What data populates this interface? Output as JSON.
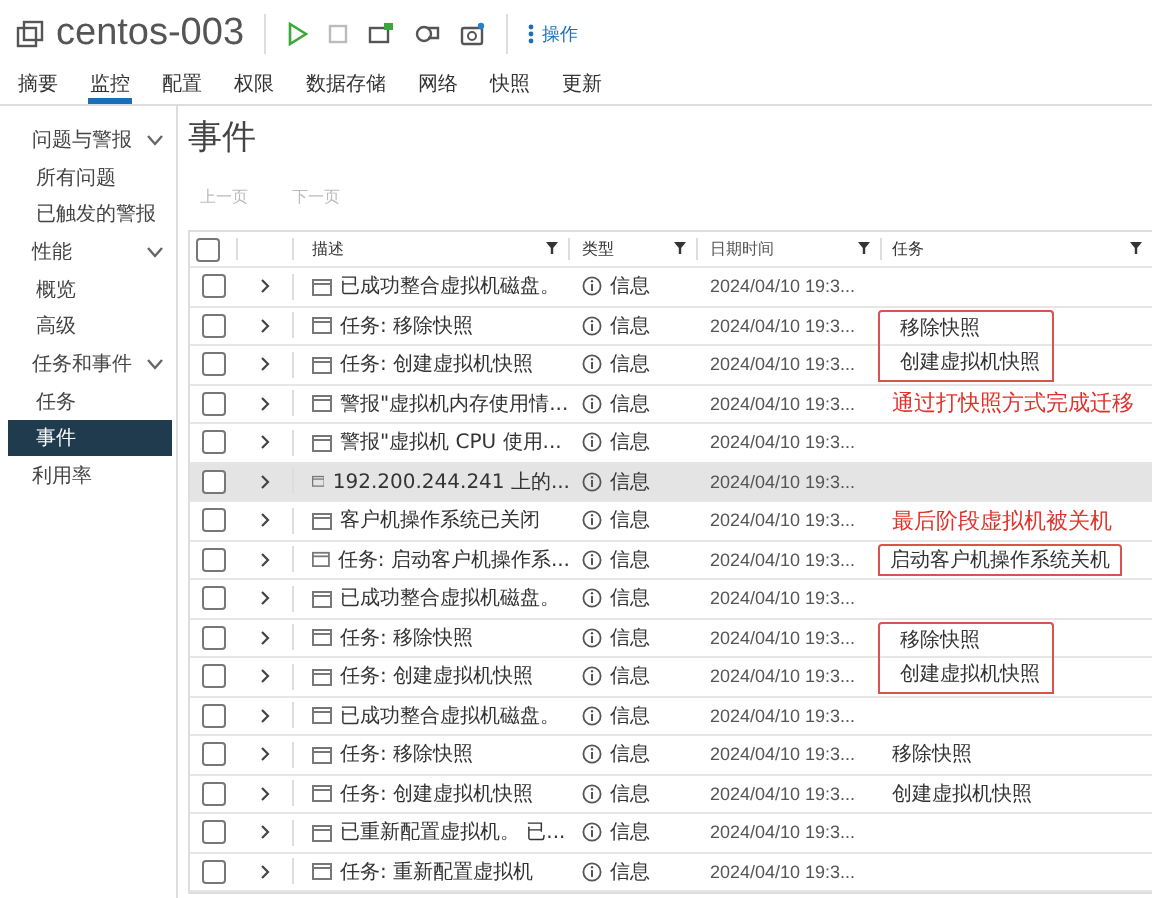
{
  "header": {
    "title": "centos-003",
    "actions_label": "操作"
  },
  "tabs": [
    {
      "label": "摘要",
      "selected": false
    },
    {
      "label": "监控",
      "selected": true
    },
    {
      "label": "配置",
      "selected": false
    },
    {
      "label": "权限",
      "selected": false
    },
    {
      "label": "数据存储",
      "selected": false
    },
    {
      "label": "网络",
      "selected": false
    },
    {
      "label": "快照",
      "selected": false
    },
    {
      "label": "更新",
      "selected": false
    }
  ],
  "sidebar": {
    "items": [
      {
        "label": "问题与警报",
        "expanded": true,
        "children": [
          {
            "label": "所有问题",
            "selected": false
          },
          {
            "label": "已触发的警报",
            "selected": false
          }
        ]
      },
      {
        "label": "性能",
        "expanded": true,
        "children": [
          {
            "label": "概览",
            "selected": false
          },
          {
            "label": "高级",
            "selected": false
          }
        ]
      },
      {
        "label": "任务和事件",
        "expanded": true,
        "children": [
          {
            "label": "任务",
            "selected": false
          },
          {
            "label": "事件",
            "selected": true
          }
        ]
      },
      {
        "label": "利用率",
        "selected": false
      }
    ]
  },
  "page_title": "事件",
  "pager": [
    {
      "label": "上一页",
      "disabled": true
    },
    {
      "label": "下一页",
      "disabled": true
    }
  ],
  "table": {
    "all_checked": false,
    "columns": [
      "描述",
      "类型",
      "日期时间",
      "任务"
    ],
    "rows": [
      {
        "description": "已成功整合虚拟机磁盘。",
        "type": "信息",
        "datetime": "2024/04/10 19:3...",
        "task": "",
        "note": "",
        "boxed": false,
        "selected": false
      },
      {
        "description": "任务: 移除快照",
        "type": "信息",
        "datetime": "2024/04/10 19:3...",
        "task": "移除快照",
        "note": "",
        "boxed": true,
        "selected": false
      },
      {
        "description": "任务: 创建虚拟机快照",
        "type": "信息",
        "datetime": "2024/04/10 19:3...",
        "task": "创建虚拟机快照",
        "note": "",
        "boxed": true,
        "selected": false
      },
      {
        "description": "警报\"虚拟机内存使用情...",
        "type": "信息",
        "datetime": "2024/04/10 19:3...",
        "task": "",
        "note": "通过打快照方式完成迁移",
        "boxed": false,
        "selected": false
      },
      {
        "description": "警报\"虚拟机 CPU 使用...",
        "type": "信息",
        "datetime": "2024/04/10 19:3...",
        "task": "",
        "note": "",
        "boxed": false,
        "selected": false
      },
      {
        "description": "192.200.244.241 上的...",
        "type": "信息",
        "datetime": "2024/04/10 19:3...",
        "task": "",
        "note": "",
        "boxed": false,
        "selected": true
      },
      {
        "description": "客户机操作系统已关闭",
        "type": "信息",
        "datetime": "2024/04/10 19:3...",
        "task": "",
        "note": "最后阶段虚拟机被关机",
        "boxed": false,
        "selected": false
      },
      {
        "description": "任务: 启动客户机操作系...",
        "type": "信息",
        "datetime": "2024/04/10 19:3...",
        "task": "启动客户机操作系统关机",
        "note": "",
        "boxed": true,
        "selected": false
      },
      {
        "description": "已成功整合虚拟机磁盘。",
        "type": "信息",
        "datetime": "2024/04/10 19:3...",
        "task": "",
        "note": "",
        "boxed": false,
        "selected": false
      },
      {
        "description": "任务: 移除快照",
        "type": "信息",
        "datetime": "2024/04/10 19:3...",
        "task": "移除快照",
        "note": "",
        "boxed": true,
        "selected": false
      },
      {
        "description": "任务: 创建虚拟机快照",
        "type": "信息",
        "datetime": "2024/04/10 19:3...",
        "task": "创建虚拟机快照",
        "note": "",
        "boxed": true,
        "selected": false
      },
      {
        "description": "已成功整合虚拟机磁盘。",
        "type": "信息",
        "datetime": "2024/04/10 19:3...",
        "task": "",
        "note": "",
        "boxed": false,
        "selected": false
      },
      {
        "description": "任务: 移除快照",
        "type": "信息",
        "datetime": "2024/04/10 19:3...",
        "task": "移除快照",
        "note": "",
        "boxed": false,
        "selected": false
      },
      {
        "description": "任务: 创建虚拟机快照",
        "type": "信息",
        "datetime": "2024/04/10 19:3...",
        "task": "创建虚拟机快照",
        "note": "",
        "boxed": false,
        "selected": false
      },
      {
        "description": "已重新配置虚拟机。 已...",
        "type": "信息",
        "datetime": "2024/04/10 19:3...",
        "task": "",
        "note": "",
        "boxed": false,
        "selected": false
      },
      {
        "description": "任务: 重新配置虚拟机",
        "type": "信息",
        "datetime": "2024/04/10 19:3...",
        "task": "",
        "note": "",
        "boxed": false,
        "selected": false
      }
    ]
  }
}
